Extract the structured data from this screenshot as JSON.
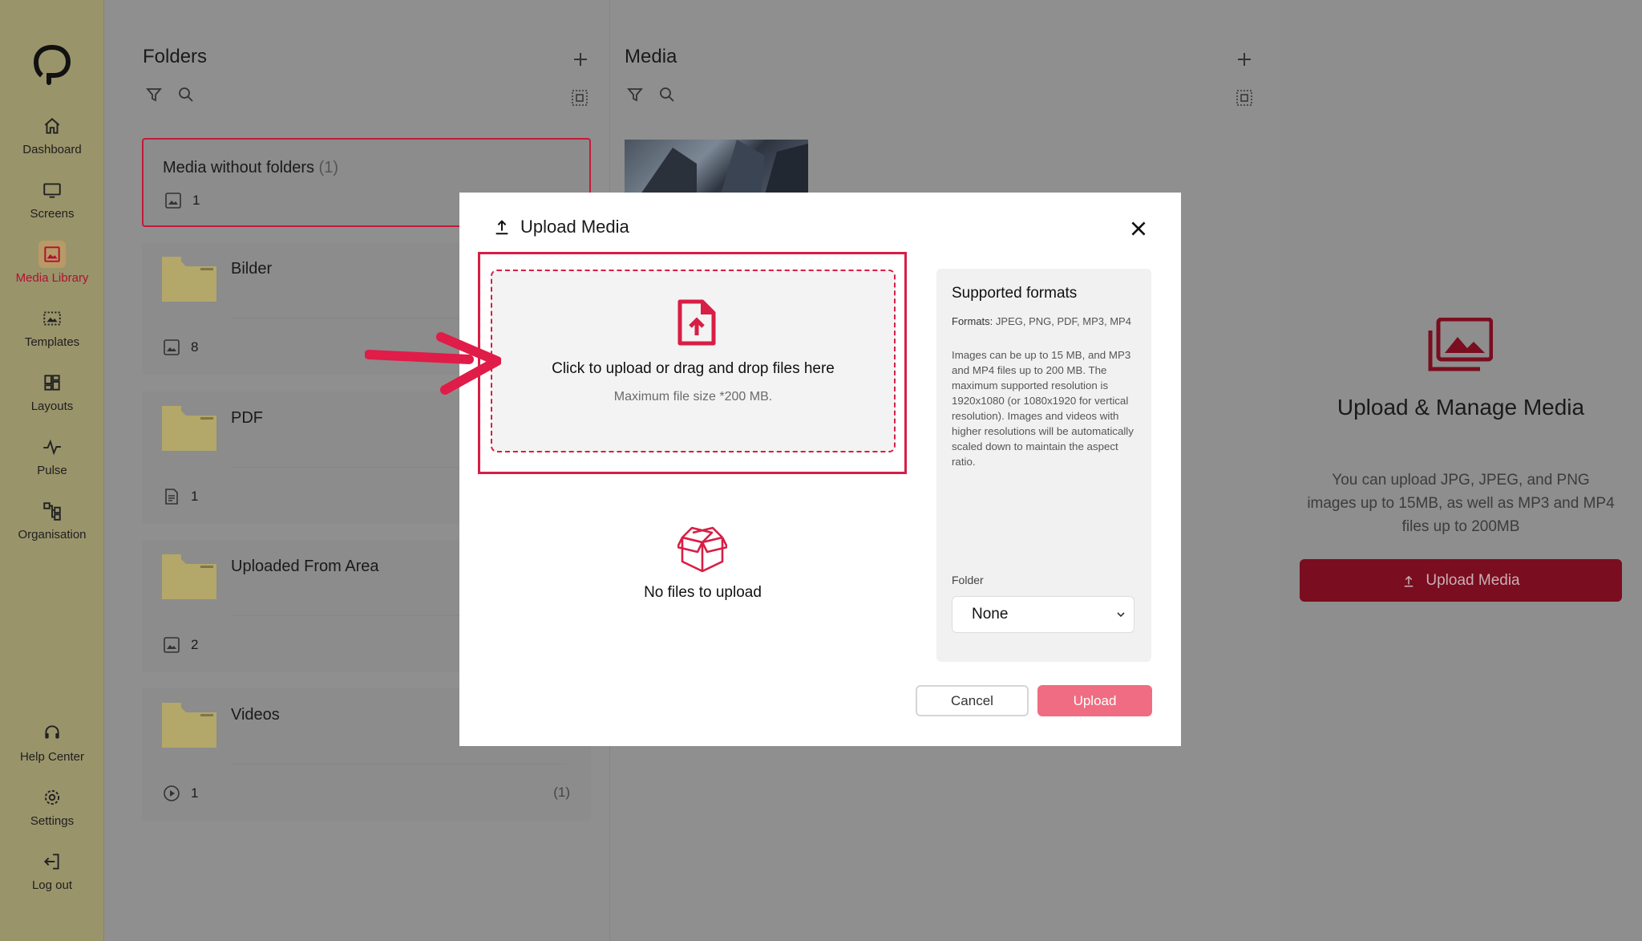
{
  "sidebar": {
    "items": [
      {
        "label": "Dashboard",
        "icon": "home-icon"
      },
      {
        "label": "Screens",
        "icon": "monitor-icon"
      },
      {
        "label": "Media Library",
        "icon": "image-icon",
        "active": true
      },
      {
        "label": "Templates",
        "icon": "template-icon"
      },
      {
        "label": "Layouts",
        "icon": "layout-icon"
      },
      {
        "label": "Pulse",
        "icon": "pulse-icon"
      },
      {
        "label": "Organisation",
        "icon": "org-icon"
      }
    ],
    "bottom_items": [
      {
        "label": "Help Center",
        "icon": "headset-icon"
      },
      {
        "label": "Settings",
        "icon": "gear-icon"
      },
      {
        "label": "Log out",
        "icon": "logout-icon"
      }
    ]
  },
  "folders_panel": {
    "title": "Folders",
    "items": [
      {
        "name": "Media without folders",
        "name_count": "(1)",
        "count": "1",
        "count_icon": "image-icon"
      },
      {
        "name": "Bilder",
        "count": "8",
        "count_icon": "image-icon"
      },
      {
        "name": "PDF",
        "count": "1",
        "count_icon": "document-icon"
      },
      {
        "name": "Uploaded From Area",
        "count": "2",
        "count_icon": "image-icon"
      },
      {
        "name": "Videos",
        "count": "1",
        "count_icon": "play-icon",
        "right_count": "(1)"
      }
    ]
  },
  "media_panel": {
    "title": "Media"
  },
  "right_panel": {
    "title": "Upload & Manage Media",
    "description": "You can upload JPG, JPEG, and PNG images up to 15MB, as well as MP3 and MP4 files up to 200MB",
    "button_label": "Upload Media"
  },
  "modal": {
    "title": "Upload Media",
    "drop_title": "Click to upload or drag and drop files here",
    "drop_subtitle": "Maximum file size *200 MB.",
    "no_files": "No files to upload",
    "formats_title": "Supported formats",
    "formats_label": "Formats:",
    "formats_list": "JPEG, PNG, PDF, MP3, MP4",
    "formats_description": "Images can be up to 15 MB, and MP3 and MP4 files up to 200 MB. The maximum supported resolution is 1920x1080 (or 1080x1920 for vertical resolution). Images and videos with higher resolutions will be automatically scaled down to maintain the aspect ratio.",
    "folder_label": "Folder",
    "folder_value": "None",
    "cancel_label": "Cancel",
    "upload_label": "Upload"
  },
  "colors": {
    "accent": "#d81e45",
    "sidebar_bg": "#9a946b",
    "upload_button": "#ef6c82",
    "right_button": "#7a0d1f"
  }
}
